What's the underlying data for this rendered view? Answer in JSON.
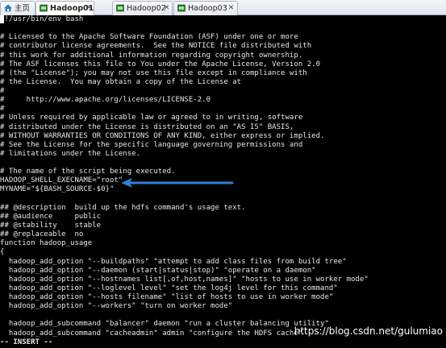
{
  "tabs": [
    {
      "label": "主页",
      "icon": "home-icon",
      "active": false
    },
    {
      "label": "Hadoop01",
      "icon": "terminal-icon",
      "active": true
    },
    {
      "label": "Hadoop02",
      "icon": "terminal-icon",
      "active": false
    },
    {
      "label": "Hadoop03",
      "icon": "terminal-icon",
      "active": false
    }
  ],
  "terminal": {
    "lines": [
      "#!/usr/bin/env bash",
      "",
      "# Licensed to the Apache Software Foundation (ASF) under one or more",
      "# contributor license agreements.  See the NOTICE file distributed with",
      "# this work for additional information regarding copyright ownership.",
      "# The ASF licenses this file to You under the Apache License, Version 2.0",
      "# (the \"License\"); you may not use this file except in compliance with",
      "# the License.  You may obtain a copy of the License at",
      "#",
      "#     http://www.apache.org/licenses/LICENSE-2.0",
      "#",
      "# Unless required by applicable law or agreed to in writing, software",
      "# distributed under the License is distributed on an \"AS IS\" BASIS,",
      "# WITHOUT WARRANTIES OR CONDITIONS OF ANY KIND, either express or implied.",
      "# See the License for the specific language governing permissions and",
      "# limitations under the License.",
      "",
      "# The name of the script being executed.",
      "HADOOP_SHELL_EXECNAME=\"root\"",
      "MYNAME=\"${BASH_SOURCE-$0}\"",
      "",
      "## @description  build up the hdfs command's usage text.",
      "## @audience     public",
      "## @stability    stable",
      "## @replaceable  no",
      "function hadoop_usage",
      "{",
      "  hadoop_add_option \"--buildpaths\" \"attempt to add class files from build tree\"",
      "  hadoop_add_option \"--daemon (start|status|stop)\" \"operate on a daemon\"",
      "  hadoop_add_option \"--hostnames list[,of,host,names]\" \"hosts to use in worker mode\"",
      "  hadoop_add_option \"--loglevel level\" \"set the log4j level for this command\"",
      "  hadoop_add_option \"--hosts filename\" \"list of hosts to use in worker mode\"",
      "  hadoop_add_option \"--workers\" \"turn on worker mode\"",
      "",
      "  hadoop_add_subcommand \"balancer\" daemon \"run a cluster balancing utility\"",
      "  hadoop_add_subcommand \"cacheadmin\" admin \"configure the HDFS cache\""
    ],
    "status_line": "-- INSERT --"
  },
  "annotation": {
    "arrow_color": "#2f7fd6"
  },
  "watermark": "https://blog.csdn.net/gulumiao"
}
